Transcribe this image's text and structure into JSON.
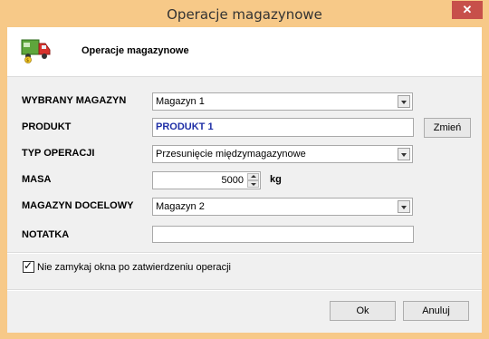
{
  "window": {
    "title": "Operacje magazynowe",
    "close_glyph": "✕"
  },
  "header": {
    "title": "Operacje magazynowe",
    "icon": "truck-icon"
  },
  "form": {
    "warehouse": {
      "label": "WYBRANY MAGAZYN",
      "value": "Magazyn 1"
    },
    "product": {
      "label": "PRODUKT",
      "value": "PRODUKT 1",
      "value_color": "#1f2fa6",
      "change_label": "Zmień"
    },
    "operation": {
      "label": "TYP OPERACJI",
      "value": "Przesunięcie międzymagazynowe"
    },
    "mass": {
      "label": "MASA",
      "value": "5000",
      "unit": "kg"
    },
    "target": {
      "label": "MAGAZYN DOCELOWY",
      "value": "Magazyn 2"
    },
    "note": {
      "label": "NOTATKA",
      "value": ""
    },
    "keep_open": {
      "label": "Nie zamykaj okna po zatwierdzeniu operacji",
      "checked": true
    }
  },
  "footer": {
    "ok_label": "Ok",
    "cancel_label": "Anuluj"
  },
  "colors": {
    "title_bar": "#f7c988",
    "close_button": "#c7504a",
    "dialog_bg": "#f0f0f0"
  }
}
